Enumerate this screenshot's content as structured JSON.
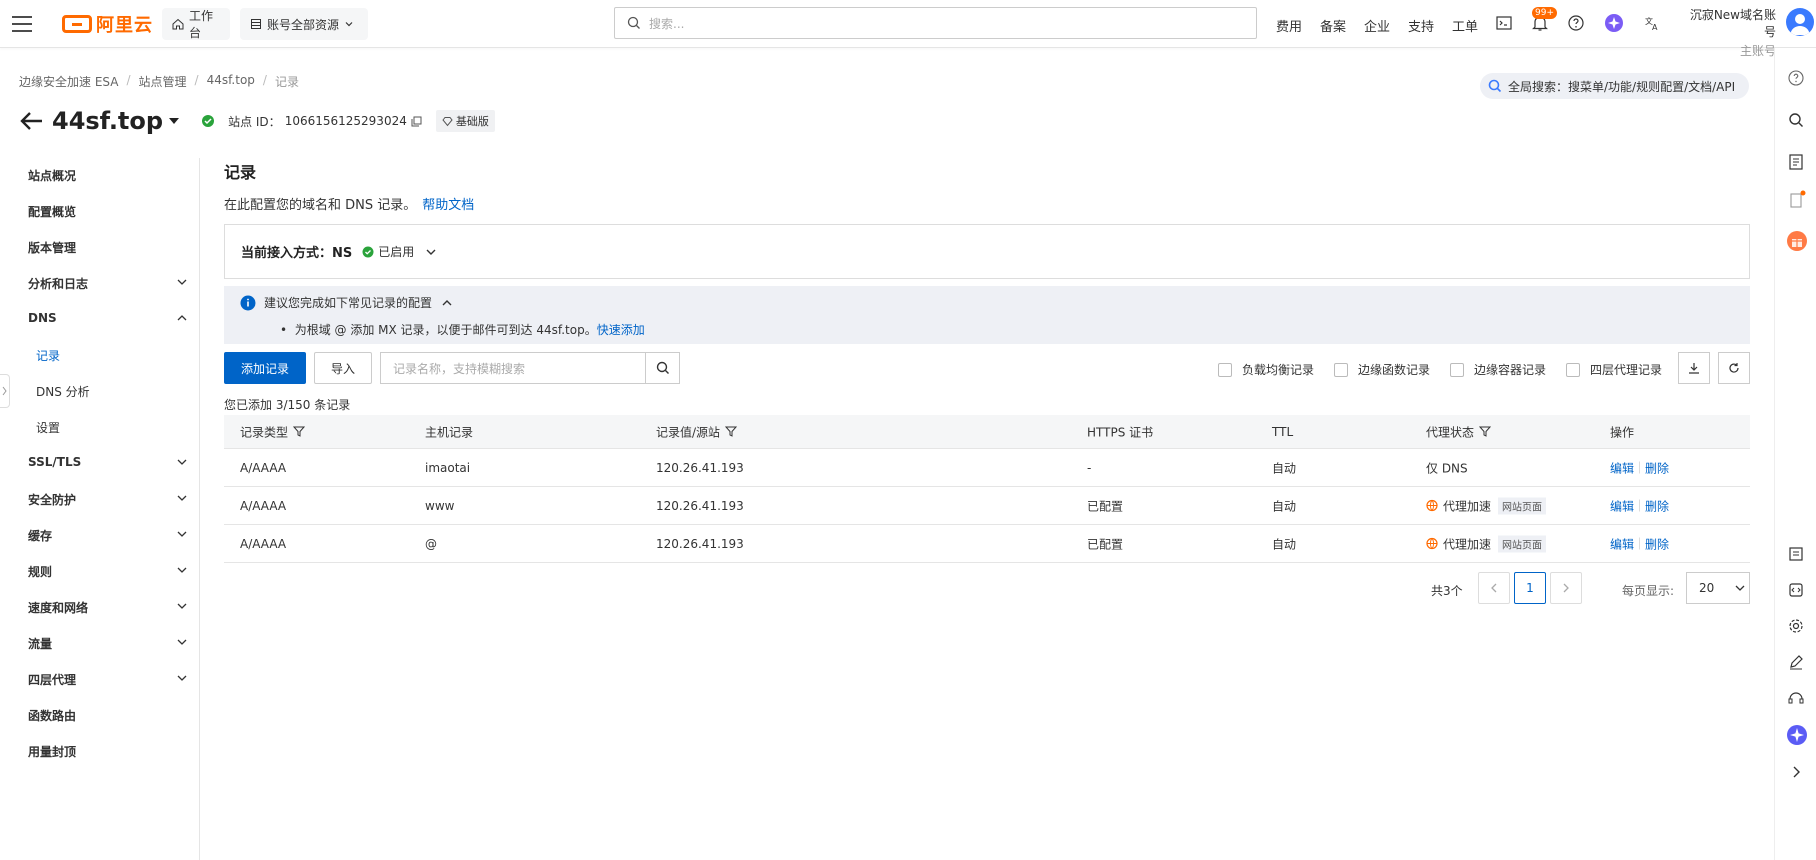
{
  "topbar": {
    "logo_text": "阿里云",
    "workbench": "工作台",
    "resources": "账号全部资源",
    "search_placeholder": "搜索...",
    "nav": [
      "费用",
      "备案",
      "企业",
      "支持",
      "工单"
    ],
    "notification_badge": "99+",
    "account_name": "沉寂New域名账号",
    "account_type": "主账号"
  },
  "breadcrumb": [
    "边缘安全加速 ESA",
    "站点管理",
    "44sf.top",
    "记录"
  ],
  "global_search": "全局搜索：搜菜单/功能/规则配置/文档/API",
  "site": {
    "name": "44sf.top",
    "id_label": "站点 ID：",
    "id_value": "1066156125293024",
    "plan": "基础版"
  },
  "sidemenu": {
    "items": [
      {
        "label": "站点概况",
        "expandable": false
      },
      {
        "label": "配置概览",
        "expandable": false
      },
      {
        "label": "版本管理",
        "expandable": false
      },
      {
        "label": "分析和日志",
        "expandable": true,
        "expanded": false
      },
      {
        "label": "DNS",
        "expandable": true,
        "expanded": true
      },
      {
        "label": "记录",
        "sub": true,
        "active": true
      },
      {
        "label": "DNS 分析",
        "sub": true
      },
      {
        "label": "设置",
        "sub": true
      },
      {
        "label": "SSL/TLS",
        "expandable": true,
        "expanded": false
      },
      {
        "label": "安全防护",
        "expandable": true,
        "expanded": false
      },
      {
        "label": "缓存",
        "expandable": true,
        "expanded": false
      },
      {
        "label": "规则",
        "expandable": true,
        "expanded": false
      },
      {
        "label": "速度和网络",
        "expandable": true,
        "expanded": false
      },
      {
        "label": "流量",
        "expandable": true,
        "expanded": false
      },
      {
        "label": "四层代理",
        "expandable": true,
        "expanded": false
      },
      {
        "label": "函数路由",
        "expandable": false
      },
      {
        "label": "用量封顶",
        "expandable": false
      }
    ]
  },
  "main": {
    "title": "记录",
    "desc": "在此配置您的域名和 DNS 记录。",
    "help_link": "帮助文档",
    "access_label": "当前接入方式：",
    "access_value": "NS",
    "access_status": "已启用",
    "tip_title": "建议您完成如下常见记录的配置",
    "tip_line": "为根域 @ 添加 MX 记录，以便于邮件可到达 44sf.top。",
    "tip_link": "快速添加",
    "add_button": "添加记录",
    "import_button": "导入",
    "search_placeholder": "记录名称，支持模糊搜索",
    "filters": [
      "负载均衡记录",
      "边缘函数记录",
      "边缘容器记录",
      "四层代理记录"
    ],
    "count_text": "您已添加 3/150 条记录"
  },
  "table": {
    "columns": [
      "记录类型",
      "主机记录",
      "记录值/源站",
      "HTTPS 证书",
      "TTL",
      "代理状态",
      "操作"
    ],
    "rows": [
      {
        "type": "A/AAAA",
        "host": "imaotai",
        "value": "120.26.41.193",
        "https": "-",
        "ttl": "自动",
        "proxy": "仅 DNS",
        "proxy_tag": "",
        "edit": "编辑",
        "delete": "删除"
      },
      {
        "type": "A/AAAA",
        "host": "www",
        "value": "120.26.41.193",
        "https": "已配置",
        "ttl": "自动",
        "proxy": "代理加速",
        "proxy_tag": "网站页面",
        "edit": "编辑",
        "delete": "删除"
      },
      {
        "type": "A/AAAA",
        "host": "@",
        "value": "120.26.41.193",
        "https": "已配置",
        "ttl": "自动",
        "proxy": "代理加速",
        "proxy_tag": "网站页面",
        "edit": "编辑",
        "delete": "删除"
      }
    ]
  },
  "pagination": {
    "total": "共3个",
    "current_page": "1",
    "page_size_label": "每页显示:",
    "page_size": "20"
  },
  "colors": {
    "brand": "#ff6a00",
    "primary": "#0064c8",
    "success": "#2aa33b"
  }
}
